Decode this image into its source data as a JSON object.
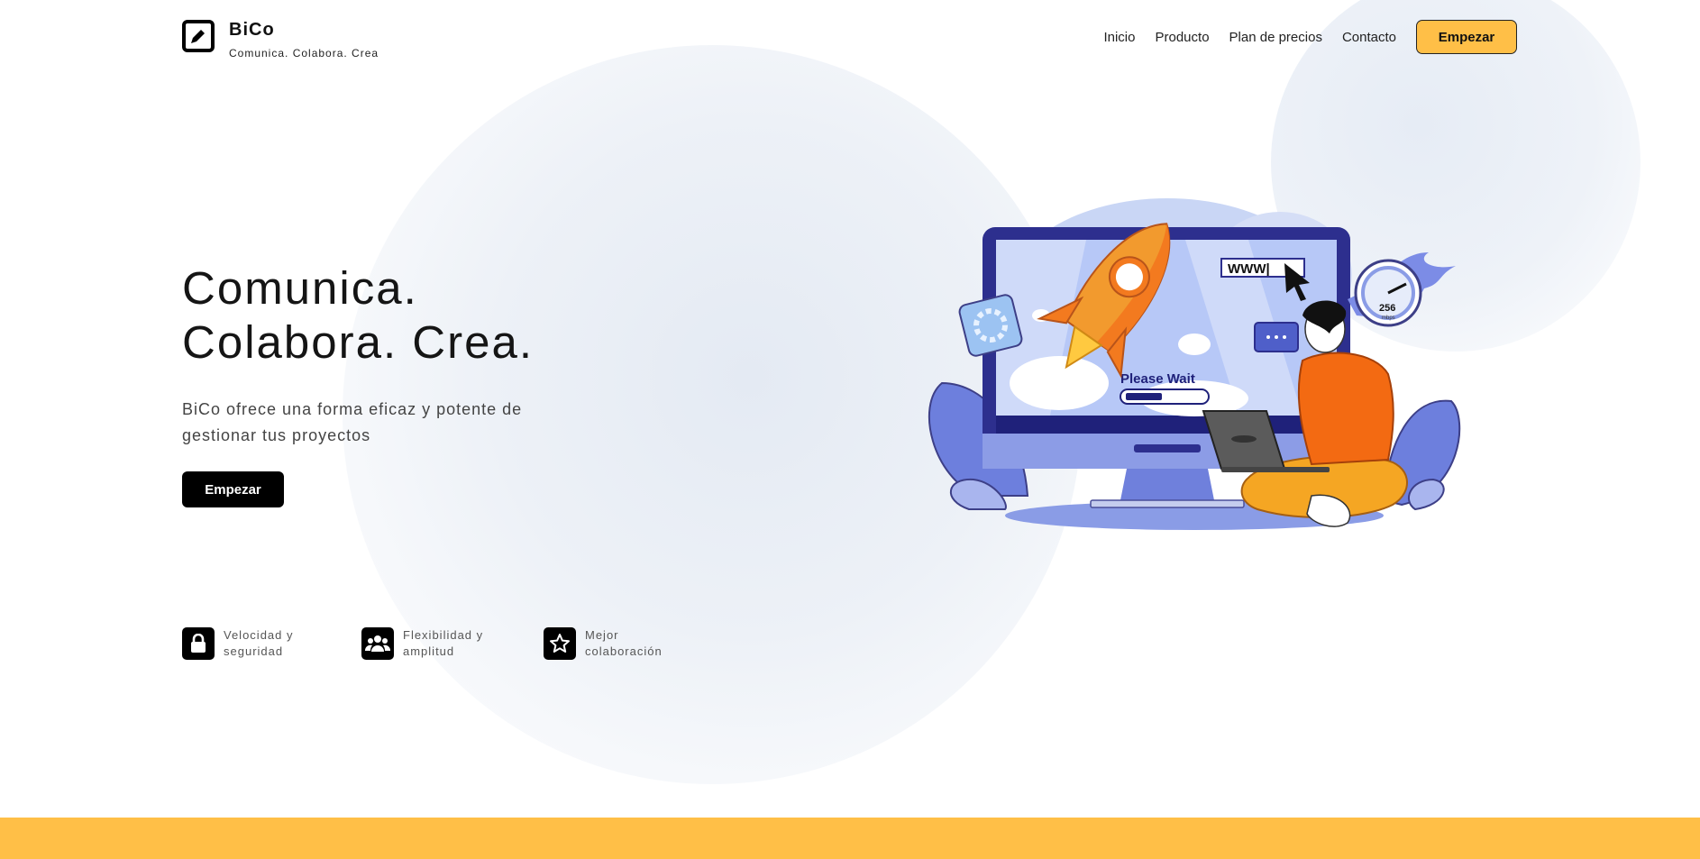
{
  "brand": {
    "name": "BiCo",
    "tagline": "Comunica. Colabora. Crea",
    "logo_icon": "pencil-icon"
  },
  "nav": {
    "links": [
      "Inicio",
      "Producto",
      "Plan de precios",
      "Contacto"
    ],
    "cta": "Empezar"
  },
  "hero": {
    "title_line1": "Comunica.",
    "title_line2": "Colabora. Crea.",
    "description": "BiCo ofrece una forma eficaz y potente de gestionar tus proyectos",
    "cta": "Empezar",
    "illustration": {
      "url_text": "WWW|",
      "status_text": "Please Wait",
      "speed_value": "256",
      "speed_unit": "mbps"
    }
  },
  "features": [
    {
      "icon": "lock-icon",
      "label": "Velocidad y seguridad"
    },
    {
      "icon": "users-icon",
      "label": "Flexibilidad y amplitud"
    },
    {
      "icon": "star-icon",
      "label": "Mejor colaboración"
    }
  ],
  "colors": {
    "accent": "#ffbf47",
    "primary_button": "#000000",
    "blob": "#e9eef5"
  }
}
